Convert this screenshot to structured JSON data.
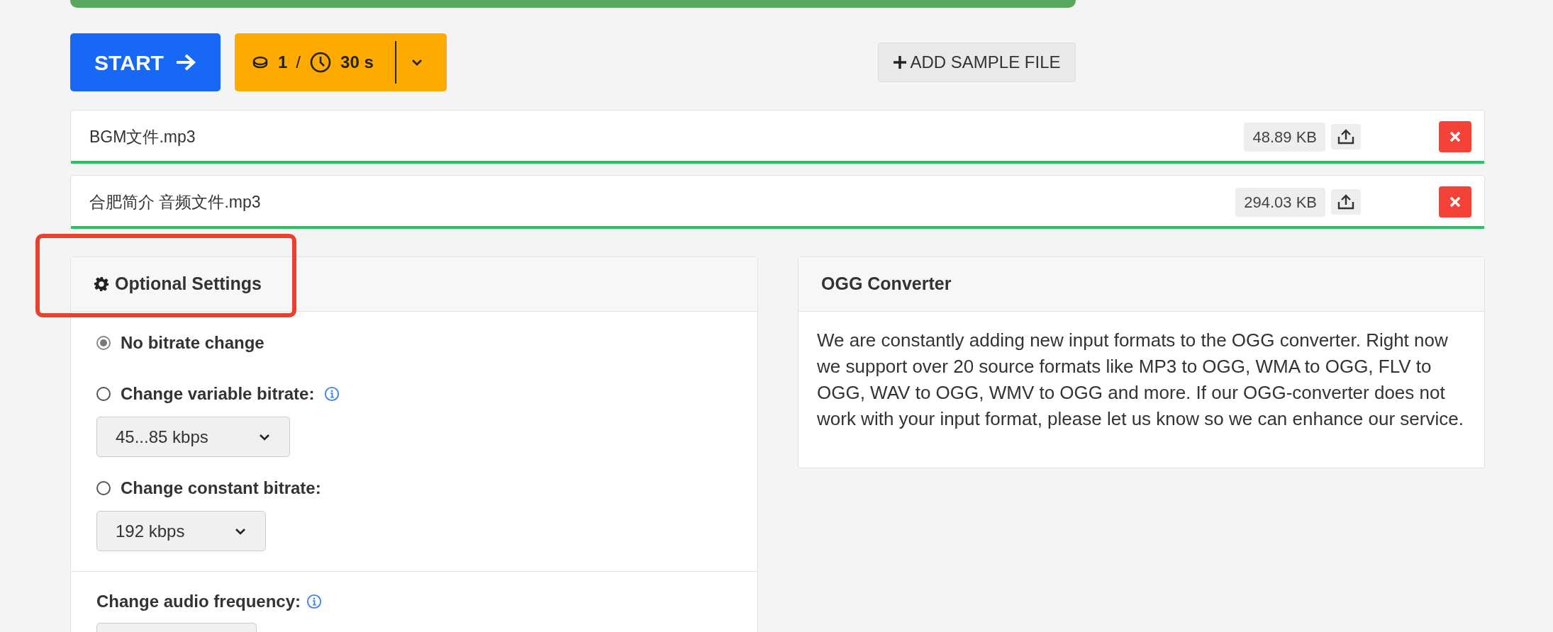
{
  "start_button": {
    "label": "START"
  },
  "credits": {
    "coins": "1",
    "separator": "/",
    "time": "30 s"
  },
  "add_sample": {
    "label": "ADD SAMPLE FILE"
  },
  "files": [
    {
      "name": "BGM文件.mp3",
      "size": "48.89 KB",
      "level": 1
    },
    {
      "name": "合肥简介 音频文件.mp3",
      "size": "294.03 KB",
      "level": 1
    }
  ],
  "optional_settings": {
    "title": "Optional Settings",
    "options": [
      {
        "label": "No bitrate change",
        "selected": true,
        "info": false
      },
      {
        "label": "Change variable bitrate:",
        "selected": false,
        "info": true,
        "select": "45...85 kbps"
      },
      {
        "label": "Change constant bitrate:",
        "selected": false,
        "info": false,
        "select": "192 kbps"
      }
    ],
    "frequency_label": "Change audio frequency:"
  },
  "info_panel": {
    "title": "OGG Converter",
    "text": "We are constantly adding new input formats to the OGG converter. Right now we support over 20 source formats like MP3 to OGG, WMA to OGG, FLV to OGG, WAV to OGG, WMV to OGG and more. If our OGG-converter does not work with your input format, please let us know so we can enhance our service."
  }
}
